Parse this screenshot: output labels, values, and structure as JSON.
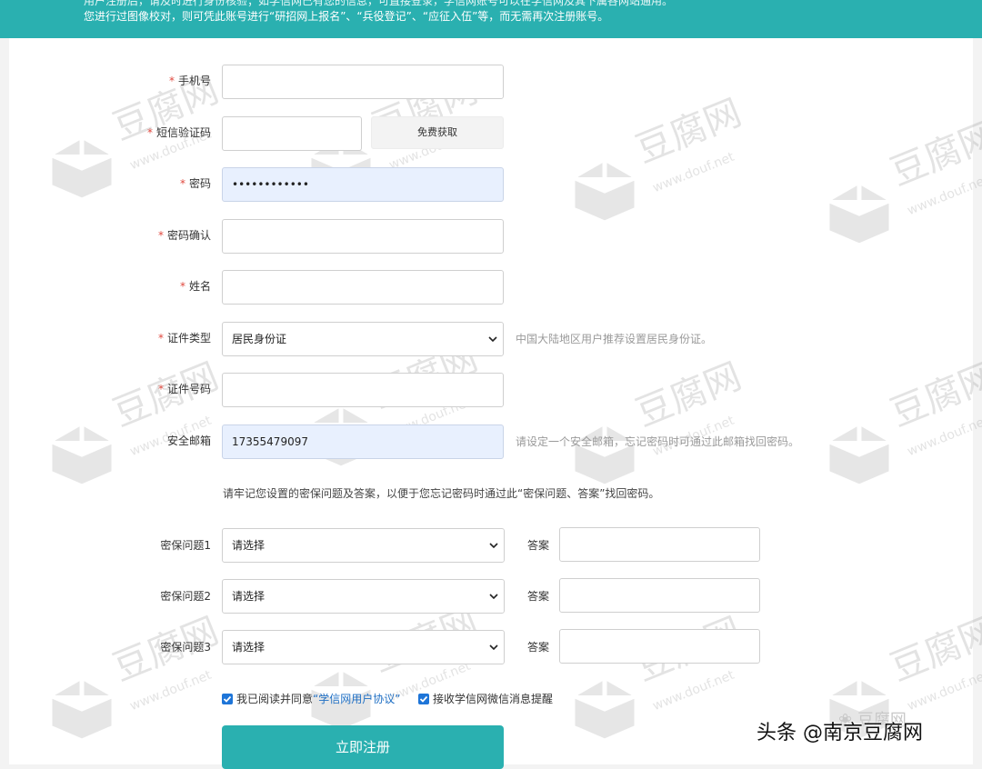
{
  "banner": {
    "line1": "用户注册后，请及时进行身份核验；如学信网已有您的信息，可直接登录，学信网账号可以在学信网及其下属各网站通用。",
    "line2": "您进行过图像校对，则可凭此账号进行“研招网上报名”、“兵役登记”、“应征入伍”等，而无需再次注册账号。"
  },
  "watermark": {
    "text": "豆腐网",
    "domain": "www.douf.net"
  },
  "form": {
    "phone": {
      "label": "手机号",
      "value": ""
    },
    "sms": {
      "label": "短信验证码",
      "value": "",
      "button": "免费获取"
    },
    "password": {
      "label": "密码",
      "value": "••••••••••••"
    },
    "password_confirm": {
      "label": "密码确认",
      "value": ""
    },
    "name": {
      "label": "姓名",
      "value": ""
    },
    "id_type": {
      "label": "证件类型",
      "value": "居民身份证",
      "hint": "中国大陆地区用户推荐设置居民身份证。"
    },
    "id_number": {
      "label": "证件号码",
      "value": ""
    },
    "email": {
      "label": "安全邮箱",
      "value": "17355479097",
      "hint": "请设定一个安全邮箱，忘记密码时可通过此邮箱找回密码。"
    },
    "security_notice": "请牢记您设置的密保问题及答案，以便于您忘记密码时通过此“密保问题、答案”找回密码。",
    "questions": [
      {
        "label": "密保问题1",
        "value": "请选择",
        "answer_label": "答案",
        "answer": ""
      },
      {
        "label": "密保问题2",
        "value": "请选择",
        "answer_label": "答案",
        "answer": ""
      },
      {
        "label": "密保问题3",
        "value": "请选择",
        "answer_label": "答案",
        "answer": ""
      }
    ],
    "agree_prefix": "我已阅读并同意",
    "agree_link": "“学信网用户协议”",
    "wechat_notify": "接收学信网微信消息提醒",
    "submit": "立即注册"
  },
  "overlay": {
    "toutiao": "头条 @南京豆腐网",
    "wx_logo": "豆腐网"
  },
  "colors": {
    "accent": "#2ab0b0",
    "required": "#e0483e",
    "link": "#1f6fc4",
    "checkbox": "#1e75d8"
  }
}
